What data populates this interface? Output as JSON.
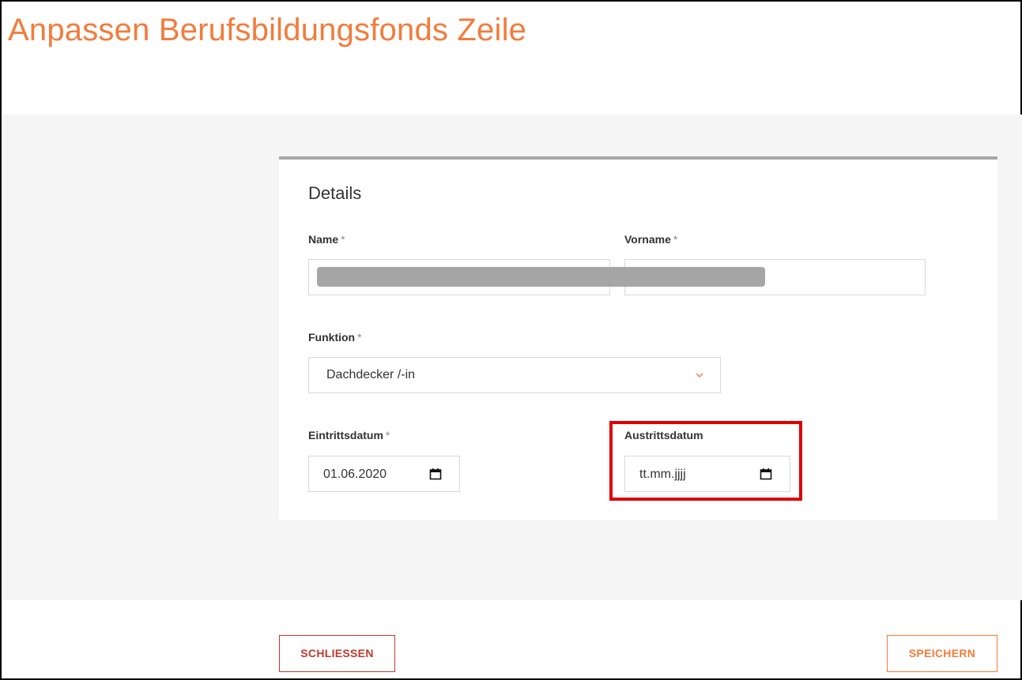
{
  "page": {
    "title": "Anpassen Berufsbildungsfonds Zeile"
  },
  "details": {
    "section_title": "Details",
    "name": {
      "label": "Name",
      "required_mark": "*",
      "value": ""
    },
    "vorname": {
      "label": "Vorname",
      "required_mark": "*",
      "value": ""
    },
    "funktion": {
      "label": "Funktion",
      "required_mark": "*",
      "selected": "Dachdecker /-in"
    },
    "eintrittsdatum": {
      "label": "Eintrittsdatum",
      "required_mark": "*",
      "value": "01.06.2020"
    },
    "austrittsdatum": {
      "label": "Austrittsdatum",
      "placeholder": "tt.mm.jjjj"
    }
  },
  "buttons": {
    "close": "SCHLIESSEN",
    "save": "SPEICHERN"
  },
  "colors": {
    "accent": "#f47b3b",
    "danger": "#c0392b",
    "highlight": "#e00000"
  },
  "icons": {
    "select_chevron": "chevron-down-icon",
    "date_picker": "calendar-icon"
  }
}
